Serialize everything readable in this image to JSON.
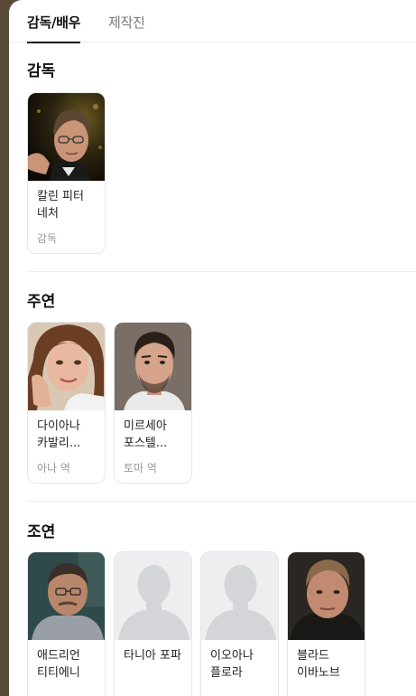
{
  "tabs": {
    "cast_label": "감독/배우",
    "crew_label": "제작진"
  },
  "sections": {
    "director": {
      "title": "감독",
      "people": [
        {
          "name": "칼린 피터 네처",
          "role": "감독"
        }
      ]
    },
    "lead": {
      "title": "주연",
      "people": [
        {
          "name": "다이아나 카발리...",
          "role": "아나 역"
        },
        {
          "name": "미르세아 포스텔...",
          "role": "토마 역"
        }
      ]
    },
    "supporting": {
      "title": "조연",
      "people": [
        {
          "name": "애드리언 티티에니",
          "role": ""
        },
        {
          "name": "타니아 포파",
          "role": ""
        },
        {
          "name": "이오아나 플로라",
          "role": ""
        },
        {
          "name": "블라드 이바노브",
          "role": ""
        }
      ]
    }
  },
  "colors": {
    "accent": "#111111",
    "muted": "#999999",
    "placeholder_bg": "#eeeef0"
  }
}
